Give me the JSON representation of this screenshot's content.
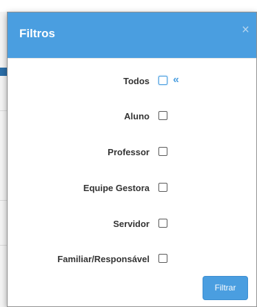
{
  "modal": {
    "title": "Filtros",
    "close_label": "×",
    "filters": [
      {
        "label": "Todos",
        "checked": false
      },
      {
        "label": "Aluno",
        "checked": false
      },
      {
        "label": "Professor",
        "checked": false
      },
      {
        "label": "Equipe Gestora",
        "checked": false
      },
      {
        "label": "Servidor",
        "checked": false
      },
      {
        "label": "Familiar/Responsável",
        "checked": false
      }
    ],
    "todos_extra_icon": "«",
    "submit_label": "Filtrar"
  },
  "colors": {
    "header_bg": "#4a9ee0",
    "button_bg": "#4a9ee0",
    "accent": "#4a9ee0"
  },
  "icons": {
    "close": "close-icon",
    "collapse": "double-chevron-left-icon"
  }
}
